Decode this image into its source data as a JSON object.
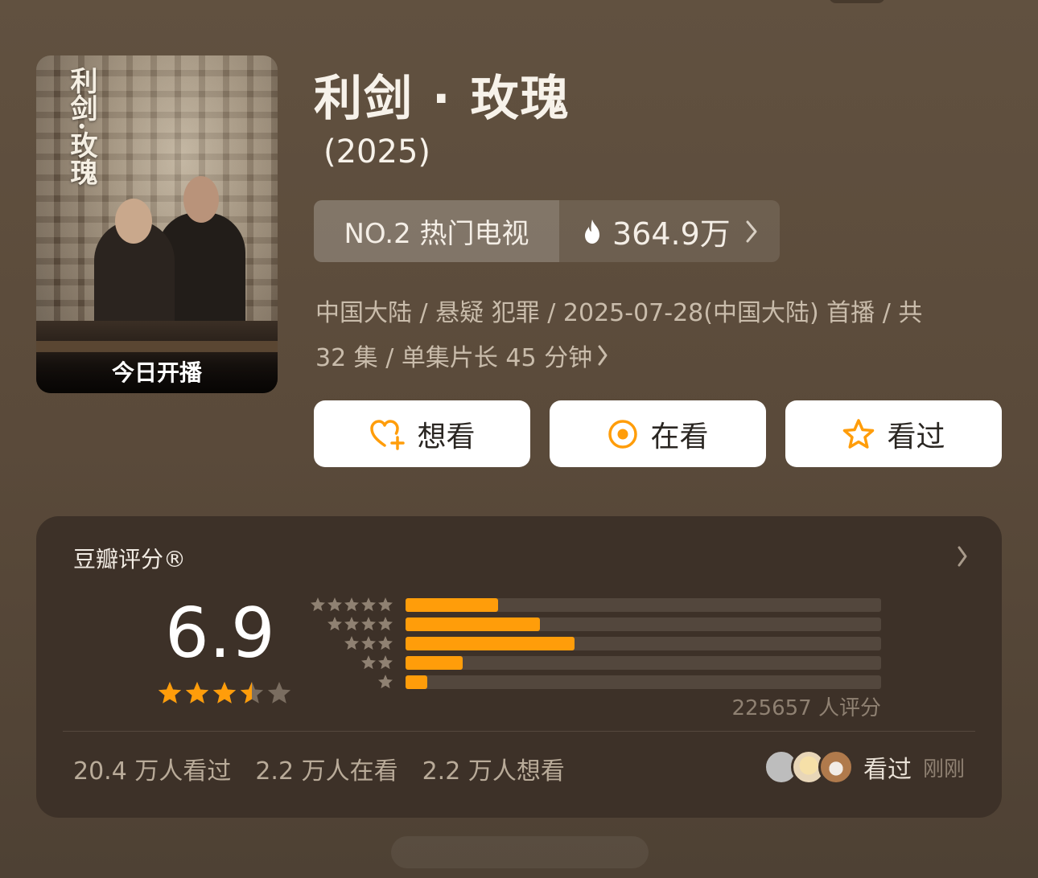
{
  "poster": {
    "title": "利剑·玫瑰",
    "label": "今日开播"
  },
  "show": {
    "title": "利剑 · 玫瑰",
    "year": "(2025)"
  },
  "rank": {
    "label": "NO.2 热门电视",
    "heat": "364.9万"
  },
  "meta": {
    "line1": "中国大陆 / 悬疑 犯罪 / 2025-07-28(中国大陆) 首播 / 共",
    "line2": "32 集 / 单集片长 45 分钟"
  },
  "actions": {
    "want": "想看",
    "watching": "在看",
    "watched": "看过"
  },
  "rating": {
    "title": "豆瓣评分®",
    "score": "6.9",
    "stars_value": 3.5,
    "distribution_fractions": [
      0.195,
      0.283,
      0.356,
      0.12,
      0.045
    ],
    "count_label": "225657 人评分"
  },
  "stats": {
    "watched": "20.4 万人看过",
    "watching": "2.2 万人在看",
    "want": "2.2 万人想看"
  },
  "friends": {
    "action": "看过",
    "time": "刚刚"
  },
  "colors": {
    "accent": "#ff9d0a",
    "card": "#3d3128"
  }
}
